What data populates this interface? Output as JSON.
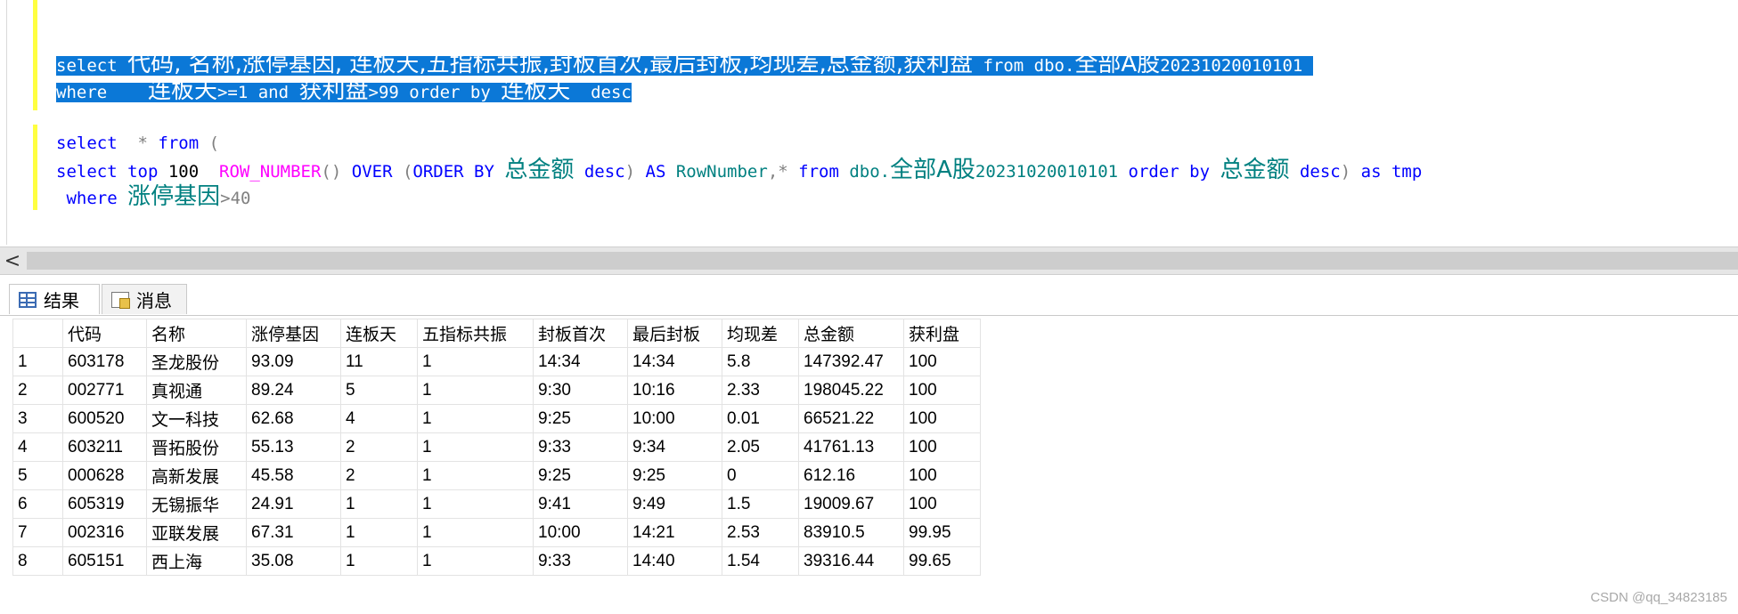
{
  "editor": {
    "line1": {
      "p1": "select ",
      "p2": "代码, 名称,涨停基因, 连板天,五指标共振,封板首次,最后封板,均现差,总金额,获利盘",
      "p3": " from dbo.",
      "p4": "全部A股",
      "p5": "20231020010101 "
    },
    "line2": {
      "p1": "where    ",
      "p2": "连板天",
      "p3": ">=1 and ",
      "p4": "获利盘",
      "p5": ">99 order by ",
      "p6": "连板天",
      "p7": "  desc"
    },
    "line3": {
      "kw_select": "select",
      "star": "  * ",
      "kw_from": "from",
      "paren": " ("
    },
    "line4": {
      "kw_select_top": "select top",
      "num": " 100  ",
      "fn_rownum": "ROW_NUMBER",
      "parens": "() ",
      "kw_over": "OVER",
      "space1": " ",
      "paren_open": "(",
      "kw_orderby": "ORDER BY ",
      "col1": "总金额",
      "space2": " ",
      "kw_desc1": "desc",
      "paren_close": ")",
      "space3": " ",
      "kw_as": "AS",
      "space4": " ",
      "alias": "RowNumber",
      "comma_star": ",* ",
      "kw_from": "from",
      "space5": " ",
      "obj1": "dbo.",
      "obj2": "全部A股",
      "obj3": "20231020010101",
      "space6": " ",
      "kw_orderby2": "order by",
      "space7": " ",
      "col2": "总金额",
      "space8": " ",
      "kw_desc2": "desc",
      "paren_close2": ")",
      "space9": " ",
      "kw_as2": "as",
      "space10": " ",
      "kw_tmp": "tmp"
    },
    "line5": {
      "indent": " ",
      "kw_where": "where",
      "space": " ",
      "col": "涨停基因",
      "cond": ">40"
    }
  },
  "scrollbar": {
    "left_arrow": "<"
  },
  "tabs": {
    "results_label": "结果",
    "messages_label": "消息"
  },
  "grid": {
    "columns": [
      "代码",
      "名称",
      "涨停基因",
      "连板天",
      "五指标共振",
      "封板首次",
      "最后封板",
      "均现差",
      "总金额",
      "获利盘"
    ],
    "rows": [
      [
        "1",
        "603178",
        "圣龙股份",
        "93.09",
        "11",
        "1",
        "14:34",
        "14:34",
        "5.8",
        "147392.47",
        "100"
      ],
      [
        "2",
        "002771",
        "真视通",
        "89.24",
        "5",
        "1",
        "9:30",
        "10:16",
        "2.33",
        "198045.22",
        "100"
      ],
      [
        "3",
        "600520",
        "文一科技",
        "62.68",
        "4",
        "1",
        "9:25",
        "10:00",
        "0.01",
        "66521.22",
        "100"
      ],
      [
        "4",
        "603211",
        "晋拓股份",
        "55.13",
        "2",
        "1",
        "9:33",
        "9:34",
        "2.05",
        "41761.13",
        "100"
      ],
      [
        "5",
        "000628",
        "高新发展",
        "45.58",
        "2",
        "1",
        "9:25",
        "9:25",
        "0",
        "612.16",
        "100"
      ],
      [
        "6",
        "605319",
        "无锡振华",
        "24.91",
        "1",
        "1",
        "9:41",
        "9:49",
        "1.5",
        "19009.67",
        "100"
      ],
      [
        "7",
        "002316",
        "亚联发展",
        "67.31",
        "1",
        "1",
        "10:00",
        "14:21",
        "2.53",
        "83910.5",
        "99.95"
      ],
      [
        "8",
        "605151",
        "西上海",
        "35.08",
        "1",
        "1",
        "9:33",
        "14:40",
        "1.54",
        "39316.44",
        "99.65"
      ]
    ]
  },
  "watermark": "CSDN @qq_34823185",
  "colors": {
    "selection": "#0b78d7",
    "keyword": "#0000ff",
    "function": "#ff00ff",
    "object": "#008080",
    "change_bar": "#ffff40"
  }
}
